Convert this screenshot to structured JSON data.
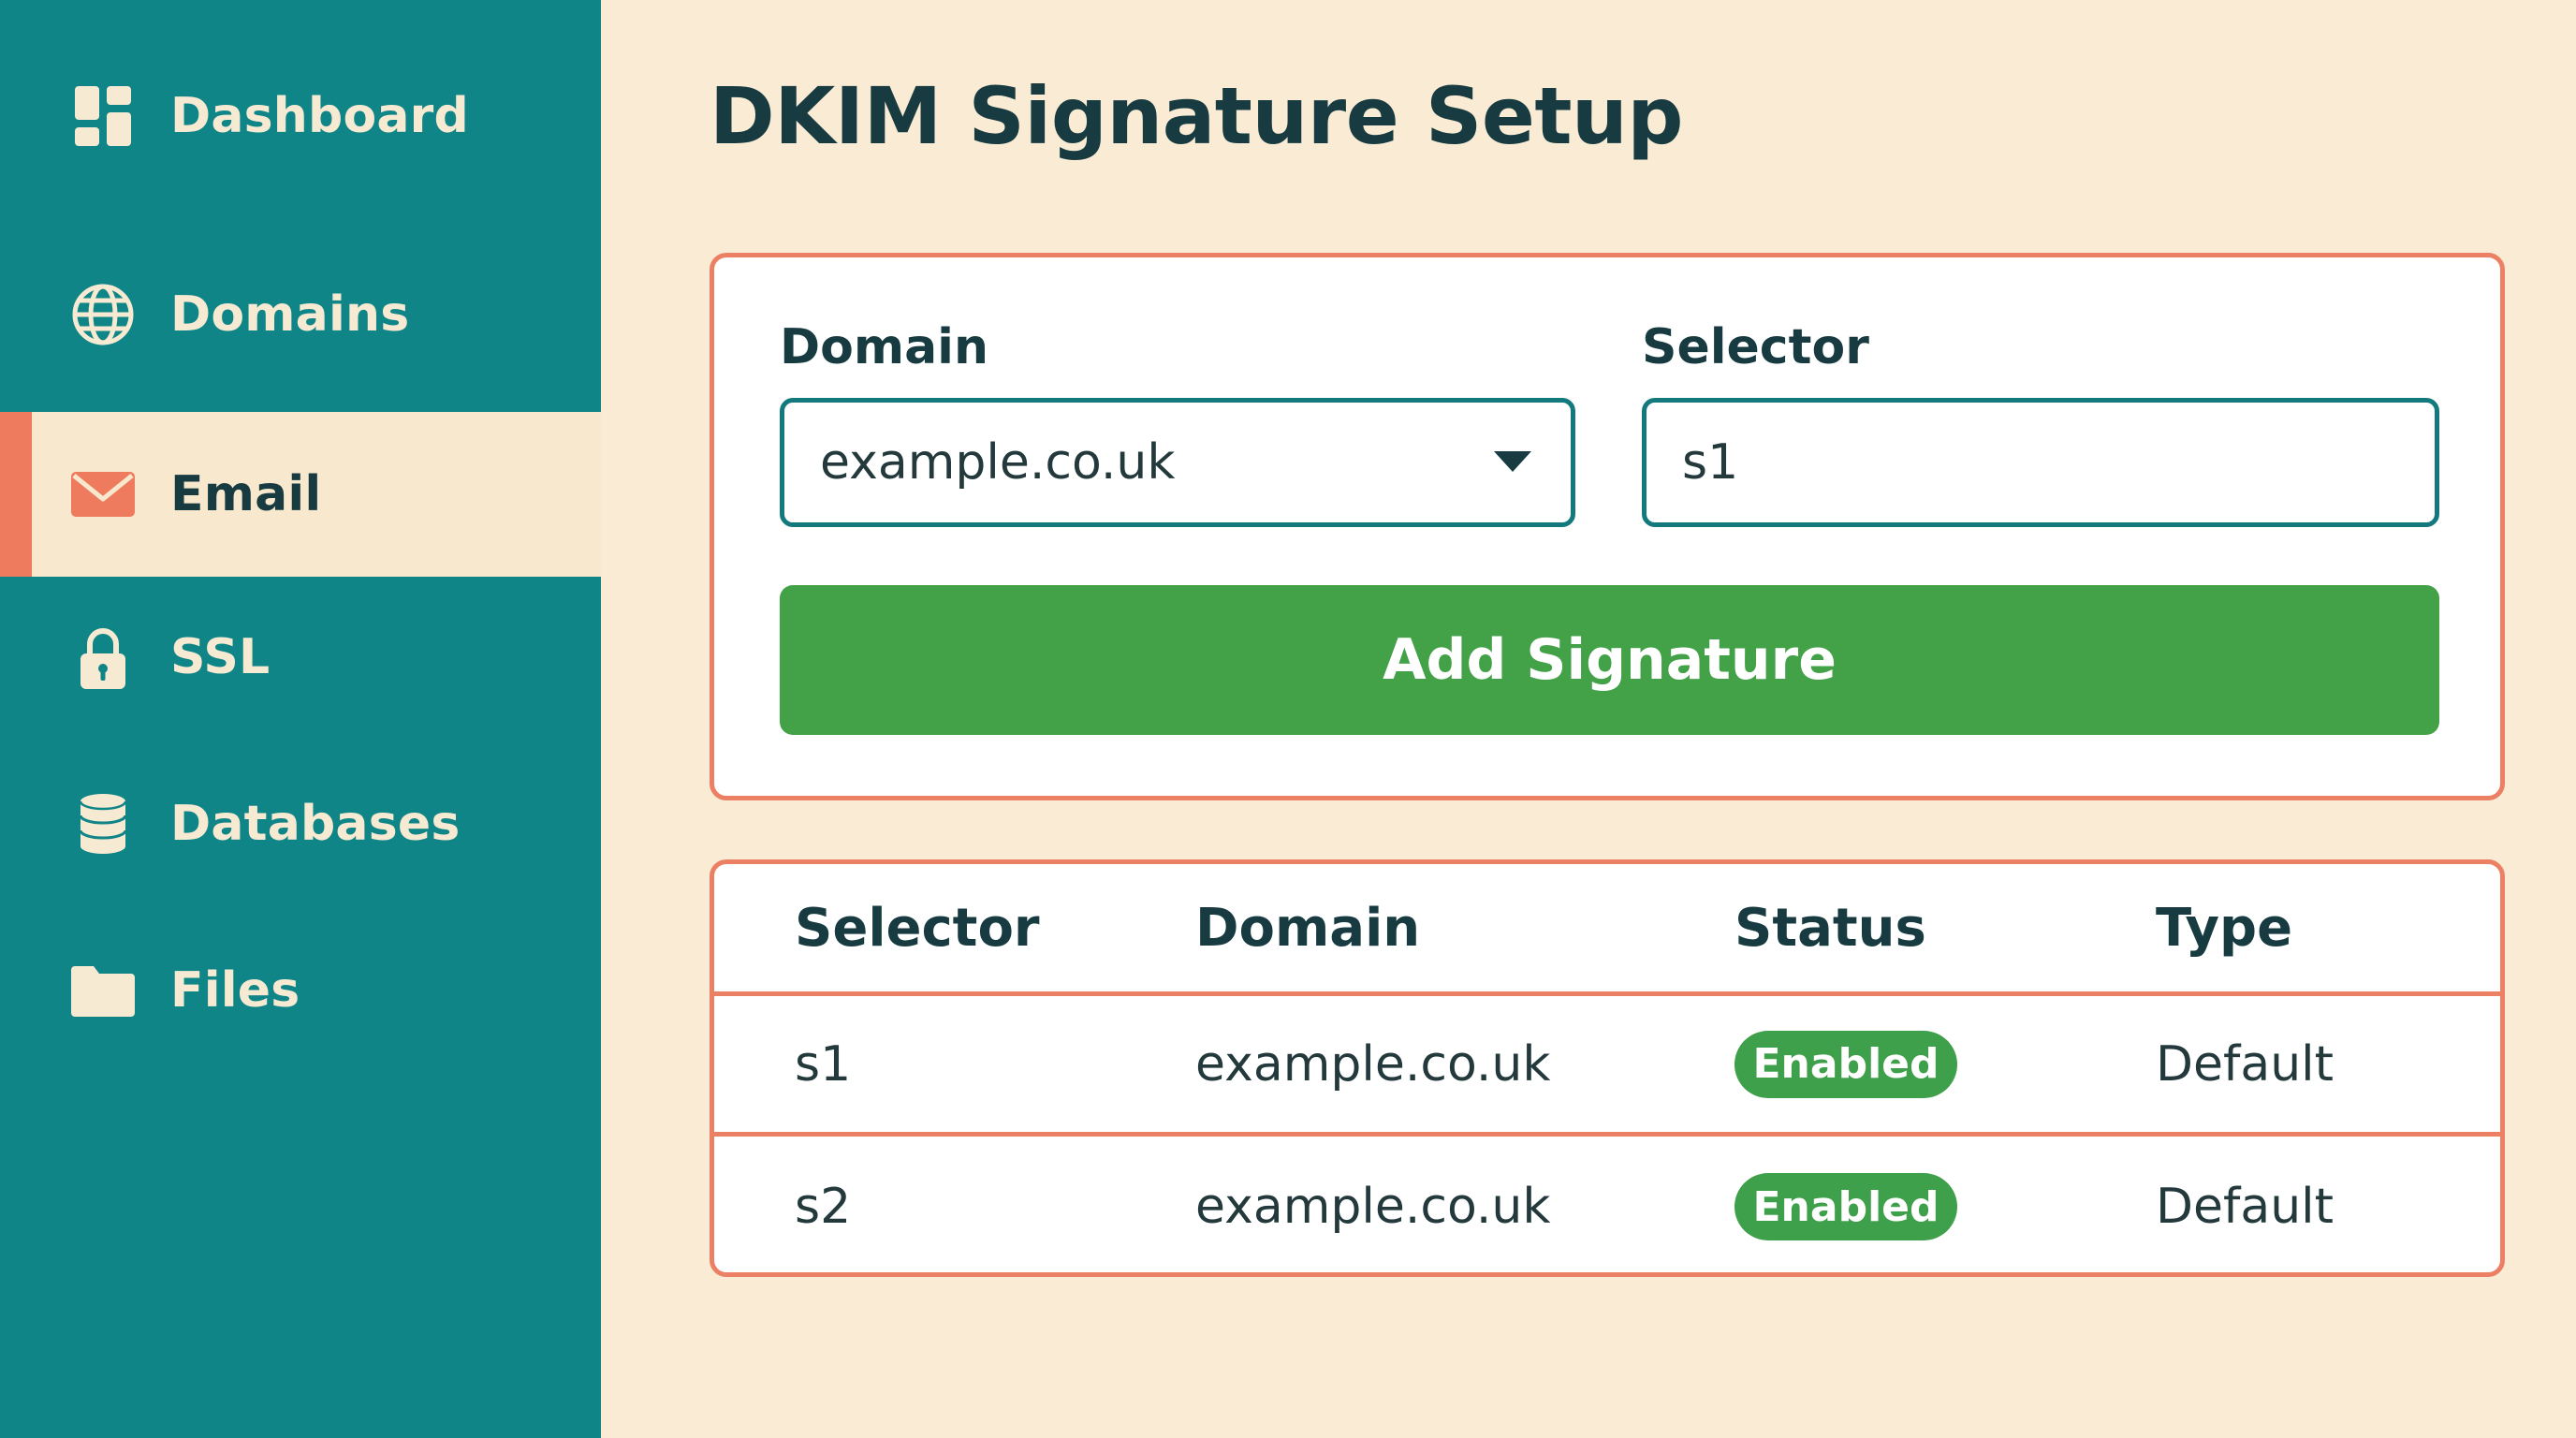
{
  "sidebar": {
    "items": [
      {
        "label": "Dashboard",
        "icon": "dashboard-icon",
        "active": false
      },
      {
        "label": "Domains",
        "icon": "globe-icon",
        "active": false
      },
      {
        "label": "Email",
        "icon": "envelope-icon",
        "active": true
      },
      {
        "label": "SSL",
        "icon": "lock-icon",
        "active": false
      },
      {
        "label": "Databases",
        "icon": "database-icon",
        "active": false
      },
      {
        "label": "Files",
        "icon": "folder-icon",
        "active": false
      }
    ]
  },
  "page": {
    "title": "DKIM Signature Setup"
  },
  "form": {
    "domain_label": "Domain",
    "domain_value": "example.co.uk",
    "selector_label": "Selector",
    "selector_value": "s1",
    "submit_label": "Add Signature"
  },
  "table": {
    "headers": [
      "Selector",
      "Domain",
      "Status",
      "Type"
    ],
    "rows": [
      {
        "selector": "s1",
        "domain": "example.co.uk",
        "status": "Enabled",
        "type": "Default"
      },
      {
        "selector": "s2",
        "domain": "example.co.uk",
        "status": "Enabled",
        "type": "Default"
      }
    ]
  },
  "colors": {
    "sidebar": "#0f8587",
    "background": "#f9ebd4",
    "accent": "#ef7b5f",
    "card_border": "#eb8065",
    "button": "#43a148",
    "badge": "#3ea04a",
    "text_dark": "#173b40"
  }
}
